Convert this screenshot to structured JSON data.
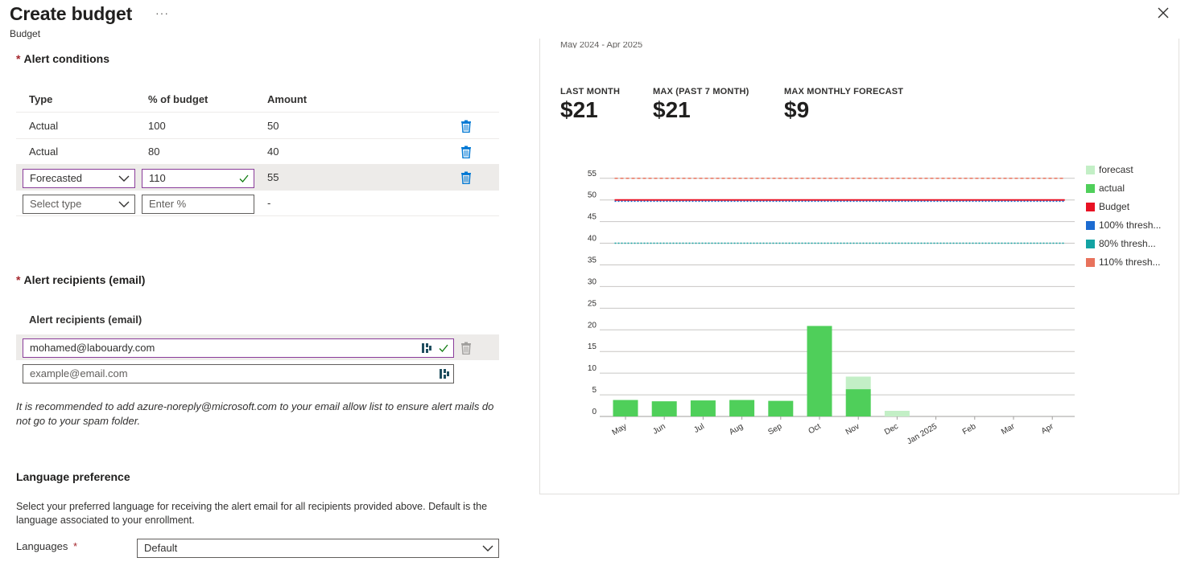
{
  "header": {
    "title": "Create budget",
    "subtitle": "Budget",
    "more_label": "···",
    "close_icon": "close-icon"
  },
  "alert_conditions": {
    "title": "Alert conditions",
    "required_mark": "*",
    "columns": [
      "Type",
      "% of budget",
      "Amount"
    ],
    "rows": [
      {
        "type": "Actual",
        "percent": "100",
        "amount": "50"
      },
      {
        "type": "Actual",
        "percent": "80",
        "amount": "40"
      }
    ],
    "editing_row": {
      "type": "Forecasted",
      "percent": "110",
      "amount": "55"
    },
    "new_row": {
      "type_placeholder": "Select type",
      "percent_placeholder": "Enter %",
      "amount": "-"
    }
  },
  "alert_recipients": {
    "title": "Alert recipients (email)",
    "required_mark": "*",
    "column": "Alert recipients (email)",
    "email": "mohamed@labouardy.com",
    "email_placeholder": "example@email.com",
    "note": "It is recommended to add azure-noreply@microsoft.com to your email allow list to ensure alert mails do not go to your spam folder."
  },
  "language": {
    "title": "Language preference",
    "description": "Select your preferred language for receiving the alert email for all recipients provided above. Default is the language associated to your enrollment.",
    "label": "Languages",
    "required_mark": "*",
    "selected": "Default"
  },
  "summary": {
    "range": "May 2024 - Apr 2025",
    "kpis": [
      {
        "label": "LAST MONTH",
        "value": "$21"
      },
      {
        "label": "MAX (PAST 7 MONTH)",
        "value": "$21"
      },
      {
        "label": "MAX MONTHLY FORECAST",
        "value": "$9"
      }
    ]
  },
  "colors": {
    "accent_focus": "#8a3c9a",
    "trash": "#0078d4",
    "check": "#107c10",
    "actual": "#4fcf5a",
    "forecast": "#c3efc6",
    "budget": "#e81123",
    "thresh100": "#1c6bd1",
    "thresh80": "#13a3a3",
    "thresh110": "#e8725c"
  },
  "chart_data": {
    "type": "bar",
    "categories": [
      "May",
      "Jun",
      "Jul",
      "Aug",
      "Sep",
      "Oct",
      "Nov",
      "Dec",
      "Jan 2025",
      "Feb",
      "Mar",
      "Apr"
    ],
    "series": [
      {
        "name": "actual",
        "values": [
          3.8,
          3.5,
          3.7,
          3.8,
          3.6,
          20.9,
          6.3,
          0,
          0,
          0,
          0,
          0
        ]
      },
      {
        "name": "forecast",
        "values": [
          0,
          0,
          0,
          0,
          0,
          0,
          2.9,
          1.3,
          0,
          0,
          0,
          0
        ]
      }
    ],
    "reference_lines": [
      {
        "name": "Budget",
        "value": 50,
        "style": "solid"
      },
      {
        "name": "100% thresh...",
        "value": 49.7,
        "style": "dotted"
      },
      {
        "name": "80% thresh...",
        "value": 40,
        "style": "dotted"
      },
      {
        "name": "110% thresh...",
        "value": 55,
        "style": "dashed"
      }
    ],
    "y_ticks": [
      0,
      5,
      10,
      15,
      20,
      25,
      30,
      35,
      40,
      45,
      50,
      55
    ],
    "ylim": [
      0,
      57
    ],
    "legend": [
      "forecast",
      "actual",
      "Budget",
      "100% thresh...",
      "80% thresh...",
      "110% thresh..."
    ],
    "legend_placement": "right",
    "grid": true
  }
}
